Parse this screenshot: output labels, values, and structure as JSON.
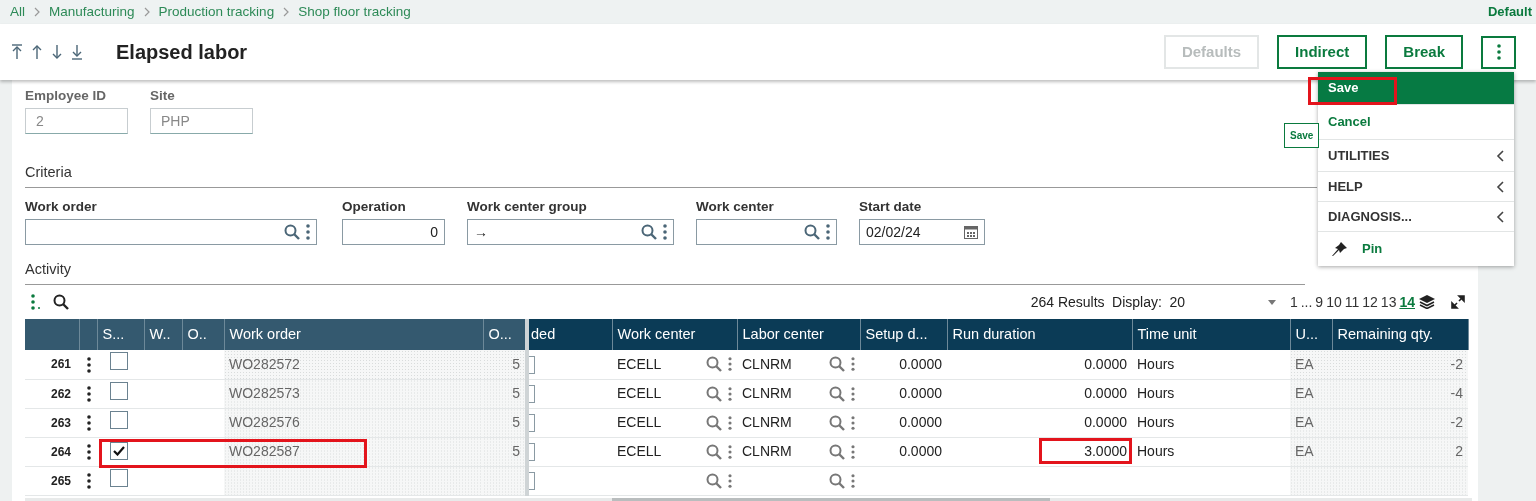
{
  "breadcrumb": [
    "All",
    "Manufacturing",
    "Production tracking",
    "Shop floor tracking"
  ],
  "top_right": "Default",
  "title": "Elapsed labor",
  "buttons": [
    {
      "label": "Defaults",
      "disabled": true
    },
    {
      "label": "Indirect",
      "disabled": false
    },
    {
      "label": "Break",
      "disabled": false
    }
  ],
  "menu": {
    "items": [
      {
        "kind": "action",
        "label": "Save",
        "selected": true,
        "annotated": true
      },
      {
        "kind": "action",
        "label": "Cancel",
        "selected": false,
        "annotated": false
      },
      {
        "kind": "submenu",
        "label": "UTILITIES",
        "selected": false,
        "annotated": false
      },
      {
        "kind": "submenu",
        "label": "HELP",
        "selected": false,
        "annotated": false
      },
      {
        "kind": "submenu",
        "label": "DIAGNOSIS...",
        "selected": false,
        "annotated": false
      },
      {
        "kind": "pin",
        "label": "Pin",
        "selected": false,
        "annotated": false
      }
    ],
    "tooltip": "Save"
  },
  "header_fields": [
    {
      "label": "Employee ID",
      "value": "2"
    },
    {
      "label": "Site",
      "value": "PHP"
    }
  ],
  "criteria": {
    "title": "Criteria",
    "fields": [
      {
        "kind": "lookup",
        "label": "Work order"
      },
      {
        "kind": "number",
        "label": "Operation",
        "value": "0"
      },
      {
        "kind": "lookup",
        "label": "Work center group",
        "value": "→"
      },
      {
        "kind": "lookup",
        "label": "Work center"
      },
      {
        "kind": "date",
        "label": "Start date",
        "value": "02/02/24"
      }
    ]
  },
  "activity": {
    "title": "Activity",
    "results": "264 Results",
    "display_label": "Display:",
    "display_value": "20",
    "pages": [
      {
        "label": "1",
        "selected": false
      },
      {
        "label": "...",
        "selected": false
      },
      {
        "label": "9",
        "selected": false
      },
      {
        "label": "10",
        "selected": false
      },
      {
        "label": "11",
        "selected": false
      },
      {
        "label": "12",
        "selected": false
      },
      {
        "label": "13",
        "selected": false
      },
      {
        "label": "14",
        "selected": true
      }
    ]
  },
  "columns": [
    {
      "label": "S...",
      "kind": "check",
      "frozen": true
    },
    {
      "label": "W..",
      "kind": "text",
      "frozen": true
    },
    {
      "label": "O..",
      "kind": "text",
      "frozen": true
    },
    {
      "label": "Work order",
      "kind": "readonly",
      "frozen": true
    },
    {
      "label": "O...",
      "kind": "readonly_num",
      "frozen": true
    },
    {
      "label": "ded",
      "kind": "stub",
      "frozen": false
    },
    {
      "label": "Work center",
      "kind": "lookup",
      "frozen": false
    },
    {
      "label": "Labor center",
      "kind": "lookup",
      "frozen": false
    },
    {
      "label": "Setup d...",
      "kind": "num",
      "frozen": false
    },
    {
      "label": "Run duration",
      "kind": "num",
      "frozen": false
    },
    {
      "label": "Time unit",
      "kind": "text",
      "frozen": false
    },
    {
      "label": "U...",
      "kind": "readonly",
      "frozen": false
    },
    {
      "label": "Remaining qty.",
      "kind": "readonly_num",
      "frozen": false
    }
  ],
  "rows": [
    {
      "number": "261",
      "checked": false,
      "annotated": false,
      "work_order": "WO282572",
      "operation": "5",
      "work_center": "ECELL",
      "labor_center": "CLNRM",
      "setup_duration": "0.0000",
      "run_duration": "0.0000",
      "time_unit": "Hours",
      "unit": "EA",
      "remaining_qty": "-2"
    },
    {
      "number": "262",
      "checked": false,
      "annotated": false,
      "work_order": "WO282573",
      "operation": "5",
      "work_center": "ECELL",
      "labor_center": "CLNRM",
      "setup_duration": "0.0000",
      "run_duration": "0.0000",
      "time_unit": "Hours",
      "unit": "EA",
      "remaining_qty": "-4"
    },
    {
      "number": "263",
      "checked": false,
      "annotated": false,
      "work_order": "WO282576",
      "operation": "5",
      "work_center": "ECELL",
      "labor_center": "CLNRM",
      "setup_duration": "0.0000",
      "run_duration": "0.0000",
      "time_unit": "Hours",
      "unit": "EA",
      "remaining_qty": "-2"
    },
    {
      "number": "264",
      "checked": true,
      "annotated": true,
      "work_order": "WO282587",
      "operation": "5",
      "work_center": "ECELL",
      "labor_center": "CLNRM",
      "setup_duration": "0.0000",
      "run_duration": "3.0000",
      "time_unit": "Hours",
      "unit": "EA",
      "remaining_qty": "2"
    },
    {
      "number": "265",
      "checked": false,
      "annotated": false
    }
  ]
}
